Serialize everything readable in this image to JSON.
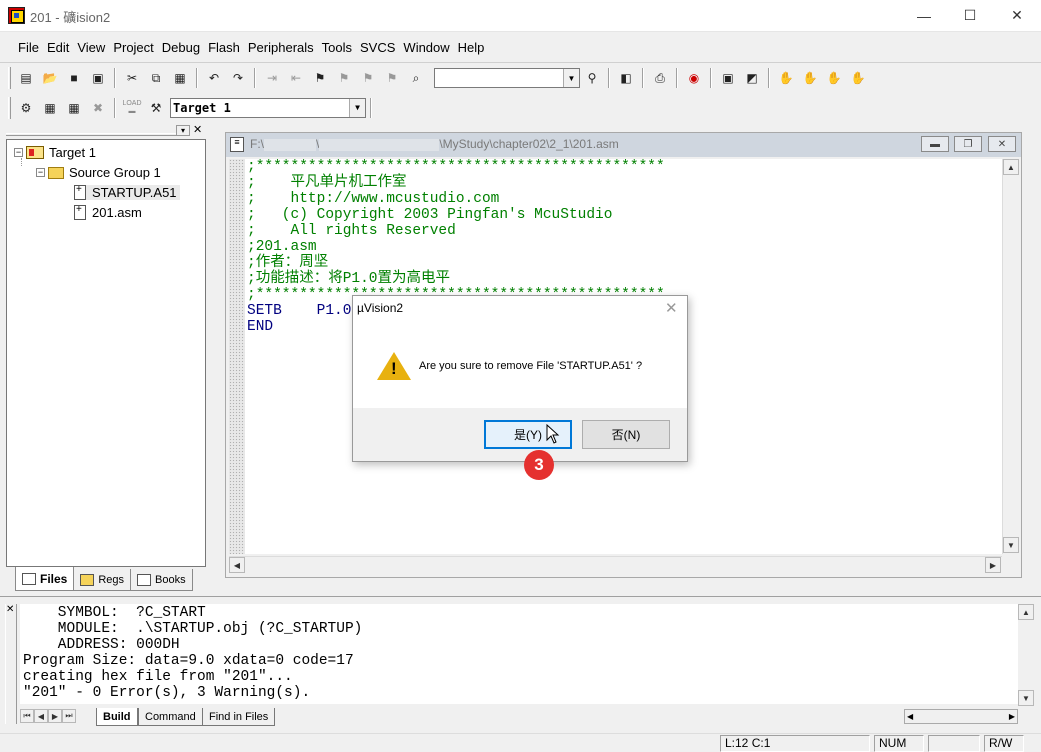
{
  "window": {
    "title": "201  - 礦ision2",
    "minimize_glyph": "—",
    "maximize_glyph": "☐",
    "close_glyph": "✕"
  },
  "menu": [
    "File",
    "Edit",
    "View",
    "Project",
    "Debug",
    "Flash",
    "Peripherals",
    "Tools",
    "SVCS",
    "Window",
    "Help"
  ],
  "toolbar": {
    "target_select": "Target 1",
    "find_value": "",
    "icons": [
      "new-file-icon",
      "open-icon",
      "save-icon",
      "save-all-icon",
      "cut-icon",
      "copy-icon",
      "paste-icon",
      "undo-icon",
      "redo-icon",
      "indent-icon",
      "outdent-icon",
      "bookmark-icon",
      "bookmark-prev-icon",
      "bookmark-next-icon",
      "bookmark-clear-icon",
      "find-in-files-icon",
      "find-icon",
      "debug-icon",
      "print-icon",
      "zoom-icon",
      "window-icon",
      "panel-icon",
      "hand-icon",
      "hand2-icon",
      "hand3-icon",
      "hand4-icon"
    ],
    "build_icons": [
      "translate-icon",
      "build-icon",
      "rebuild-icon",
      "stop-build-icon",
      "load-icon",
      "options-icon"
    ],
    "load_label": "LOAD"
  },
  "project": {
    "tree": [
      {
        "label": "Target 1",
        "level": 0,
        "expander": "−",
        "type": "target"
      },
      {
        "label": "Source Group 1",
        "level": 1,
        "expander": "−",
        "type": "folder"
      },
      {
        "label": "STARTUP.A51",
        "level": 2,
        "type": "file",
        "selected": true
      },
      {
        "label": "201.asm",
        "level": 2,
        "type": "file",
        "selected": false
      }
    ],
    "tabs": [
      "Files",
      "Regs",
      "Books"
    ],
    "active_tab": "Files"
  },
  "editor": {
    "path_prefix": "F:\\",
    "path_sep": "\\",
    "path_suffix": "\\MyStudy\\chapter02\\2_1\\201.asm",
    "lines": [
      ";***********************************************",
      ";    平凡单片机工作室",
      ";    http://www.mcustudio.com",
      ";   (c) Copyright 2003 Pingfan's McuStudio",
      ";    All rights Reserved",
      ";201.asm",
      ";作者：周坚",
      ";功能描述：将P1.0置为高电平",
      ";***********************************************",
      "SETB    P1.0",
      "END"
    ],
    "status_line": "L:12 C:1"
  },
  "output": {
    "lines": [
      "    SYMBOL:  ?C_START",
      "    MODULE:  .\\STARTUP.obj (?C_STARTUP)",
      "    ADDRESS: 000DH",
      "Program Size: data=9.0 xdata=0 code=17",
      "creating hex file from \"201\"...",
      "\"201\" - 0 Error(s), 3 Warning(s)."
    ],
    "tabs": [
      "Build",
      "Command",
      "Find in Files"
    ],
    "active_tab": "Build"
  },
  "status": {
    "position": "L:12 C:1",
    "num": "NUM",
    "rw": "R/W"
  },
  "dialog": {
    "title": "µVision2",
    "message": "Are you sure to remove File 'STARTUP.A51' ?",
    "yes_label": "是(Y)",
    "no_label": "否(N)",
    "icon": "warning-icon"
  },
  "annotation": {
    "step_number": "3",
    "color": "#e5312f"
  }
}
